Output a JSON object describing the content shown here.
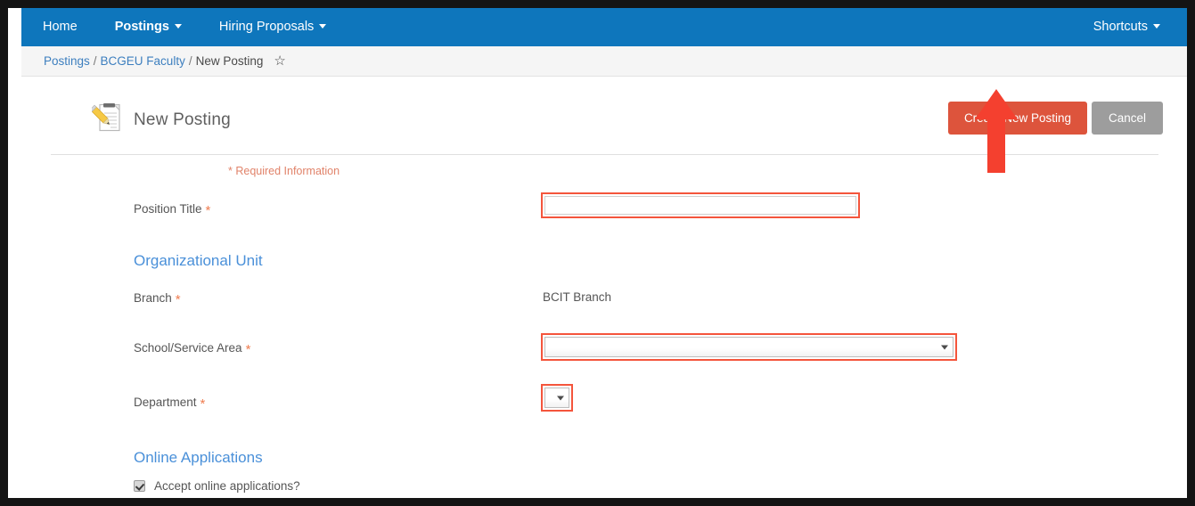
{
  "nav": {
    "items": [
      {
        "label": "Home",
        "has_caret": false,
        "bold": false
      },
      {
        "label": "Postings",
        "has_caret": true,
        "bold": true
      },
      {
        "label": "Hiring Proposals",
        "has_caret": true,
        "bold": false
      }
    ],
    "right_label": "Shortcuts"
  },
  "breadcrumb": {
    "first": "Postings",
    "sep1": "/",
    "second": "BCGEU Faculty",
    "sep2": "/",
    "current": "New Posting",
    "star": "☆"
  },
  "header": {
    "title": "New Posting",
    "primary_button": "Create New Posting",
    "cancel_button": "Cancel",
    "icon": "notepad-pencil-icon"
  },
  "form": {
    "required_note": "* Required Information",
    "position_title": {
      "label": "Position Title",
      "required_marker": "*",
      "value": "",
      "placeholder": ""
    },
    "organizational_unit": {
      "heading": "Organizational Unit",
      "branch": {
        "label": "Branch",
        "required_marker": "*",
        "value": "BCIT Branch"
      },
      "school_service_area": {
        "label": "School/Service Area",
        "required_marker": "*",
        "selected": ""
      },
      "department": {
        "label": "Department",
        "required_marker": "*",
        "selected": ""
      }
    },
    "online_applications": {
      "heading": "Online Applications",
      "accept_label": "Accept online applications?",
      "accept_checked": true
    }
  },
  "annotation": {
    "arrow": "red-up-arrow",
    "color": "#f4402f"
  },
  "colors": {
    "nav_blue": "#0e76bc",
    "primary_orange": "#dd543c",
    "cancel_gray": "#9d9d9d",
    "link_blue": "#3d7fbf",
    "section_blue": "#4a90d9",
    "required_orange": "#ef7d50",
    "highlight_red": "#f4553c"
  }
}
